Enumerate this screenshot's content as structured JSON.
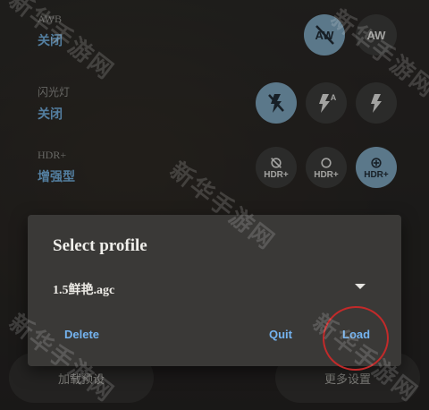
{
  "settings": [
    {
      "title": "AWB",
      "value": "关闭"
    },
    {
      "title": "闪光灯",
      "value": "关闭"
    },
    {
      "title": "HDR+",
      "value": "增强型"
    }
  ],
  "icons": {
    "awb": [
      "awb-off-icon",
      "awb-auto-icon"
    ],
    "flash": [
      "flash-off-icon",
      "flash-auto-icon",
      "flash-on-icon"
    ],
    "hdr": [
      {
        "icon": "hdr-off-icon",
        "label": "HDR+"
      },
      {
        "icon": "hdr-on-icon",
        "label": "HDR+"
      },
      {
        "icon": "hdr-enhanced-icon",
        "label": "HDR+"
      }
    ]
  },
  "bottom": {
    "left": "加载预设",
    "right": "更多设置"
  },
  "dialog": {
    "title": "Select profile",
    "selected": "1.5鲜艳.agc",
    "delete": "Delete",
    "quit": "Quit",
    "load": "Load"
  },
  "watermark": "新华手游网",
  "colors": {
    "accent": "#74b3f0",
    "value": "#6fa9d6",
    "active": "#7aa0b8",
    "annotation": "#c22a2a"
  }
}
